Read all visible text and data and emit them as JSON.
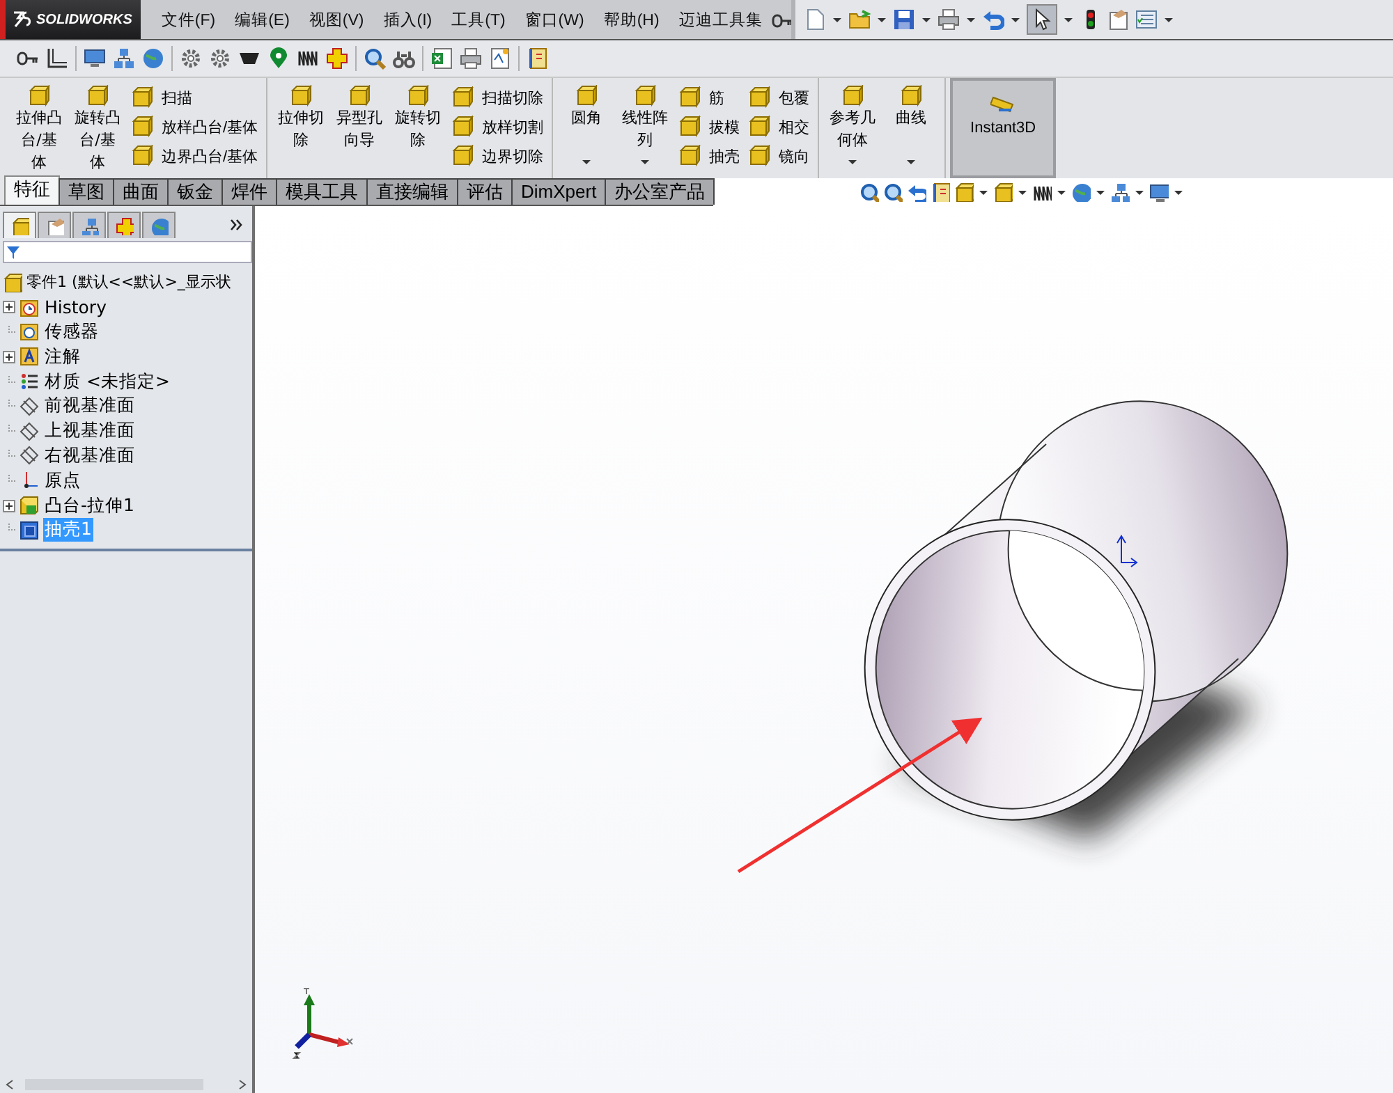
{
  "logo": {
    "text": "SOLIDWORKS"
  },
  "menu": [
    "文件(F)",
    "编辑(E)",
    "视图(V)",
    "插入(I)",
    "工具(T)",
    "窗口(W)",
    "帮助(H)",
    "迈迪工具集"
  ],
  "ribbon": {
    "groups": [
      {
        "items": [
          {
            "kind": "large",
            "label": "拉伸凸台/基体",
            "dropdown": false
          },
          {
            "kind": "large",
            "label": "旋转凸台/基体",
            "dropdown": false
          },
          {
            "kind": "column",
            "items": [
              "扫描",
              "放样凸台/基体",
              "边界凸台/基体"
            ]
          }
        ]
      },
      {
        "items": [
          {
            "kind": "large",
            "label": "拉伸切除",
            "dropdown": false
          },
          {
            "kind": "large",
            "label": "异型孔向导",
            "dropdown": false
          },
          {
            "kind": "large",
            "label": "旋转切除",
            "dropdown": false
          },
          {
            "kind": "column",
            "items": [
              "扫描切除",
              "放样切割",
              "边界切除"
            ]
          }
        ]
      },
      {
        "items": [
          {
            "kind": "large",
            "label": "圆角",
            "dropdown": true
          },
          {
            "kind": "large",
            "label": "线性阵列",
            "dropdown": true
          },
          {
            "kind": "column",
            "items": [
              "筋",
              "拔模",
              "抽壳"
            ]
          },
          {
            "kind": "column",
            "items": [
              "包覆",
              "相交",
              "镜向"
            ]
          }
        ]
      },
      {
        "items": [
          {
            "kind": "large",
            "label": "参考几何体",
            "dropdown": true
          },
          {
            "kind": "large",
            "label": "曲线",
            "dropdown": true
          }
        ]
      }
    ],
    "instant3d": {
      "label": "Instant3D",
      "on": true
    }
  },
  "tabs": [
    {
      "label": "特征",
      "selected": true
    },
    {
      "label": "草图",
      "selected": false
    },
    {
      "label": "曲面",
      "selected": false
    },
    {
      "label": "钣金",
      "selected": false
    },
    {
      "label": "焊件",
      "selected": false
    },
    {
      "label": "模具工具",
      "selected": false
    },
    {
      "label": "直接编辑",
      "selected": false
    },
    {
      "label": "评估",
      "selected": false
    },
    {
      "label": "DimXpert",
      "selected": false
    },
    {
      "label": "办公室产品",
      "selected": false
    }
  ],
  "panel_tabs": [
    {
      "selected": true
    },
    {
      "selected": false
    },
    {
      "selected": false
    },
    {
      "selected": false
    },
    {
      "selected": false
    }
  ],
  "tree": {
    "root": "零件1  (默认<<默认>_显示状",
    "items": [
      {
        "label": "History",
        "kind": "history",
        "expander": true,
        "selected": false
      },
      {
        "label": "传感器",
        "kind": "sensor",
        "expander": false,
        "selected": false
      },
      {
        "label": "注解",
        "kind": "annotation",
        "expander": true,
        "selected": false
      },
      {
        "label": "材质 <未指定>",
        "kind": "material",
        "expander": false,
        "selected": false
      },
      {
        "label": "前视基准面",
        "kind": "plane",
        "expander": false,
        "selected": false
      },
      {
        "label": "上视基准面",
        "kind": "plane",
        "expander": false,
        "selected": false
      },
      {
        "label": "右视基准面",
        "kind": "plane",
        "expander": false,
        "selected": false
      },
      {
        "label": "原点",
        "kind": "origin",
        "expander": false,
        "selected": false
      },
      {
        "label": "凸台-拉伸1",
        "kind": "feature",
        "expander": true,
        "selected": false
      },
      {
        "label": "抽壳1",
        "kind": "shell",
        "expander": false,
        "selected": true
      }
    ]
  }
}
